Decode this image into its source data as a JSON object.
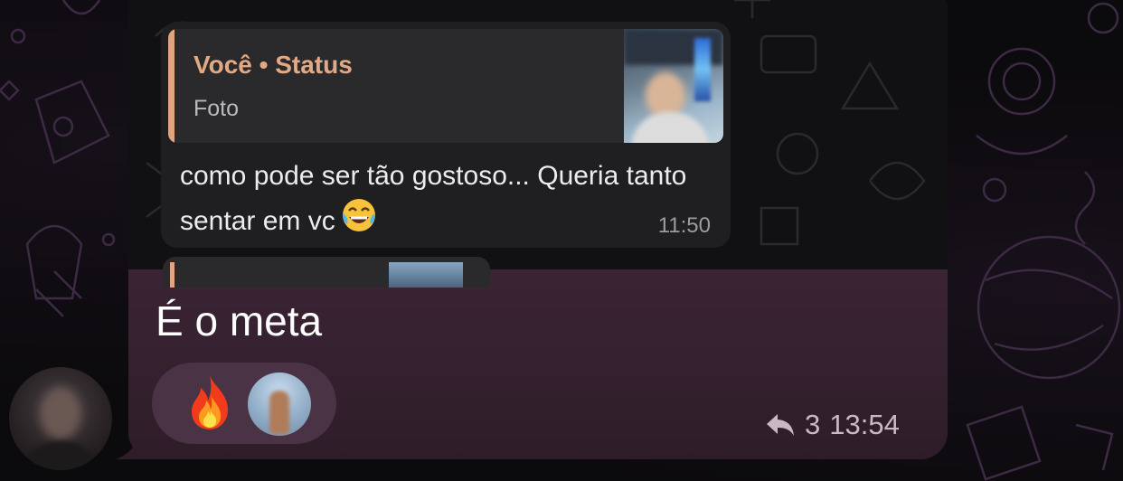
{
  "quoted_message": {
    "reply": {
      "author": "Você • Status",
      "snippet": "Foto"
    },
    "text": "como pode ser tão gostoso... Queria tanto sentar em vc",
    "time": "11:50"
  },
  "message": {
    "text": "É o meta",
    "reactions": [
      {
        "type": "emoji",
        "icon": "fire-icon"
      },
      {
        "type": "avatar",
        "icon": "reactor-avatar"
      }
    ],
    "reply_count": "3",
    "time": "13:54"
  },
  "colors": {
    "bubble": "#33202e",
    "reply_accent": "#e1a984",
    "reaction_pill": "#4a3344",
    "meta_text": "#c8b9c4"
  }
}
